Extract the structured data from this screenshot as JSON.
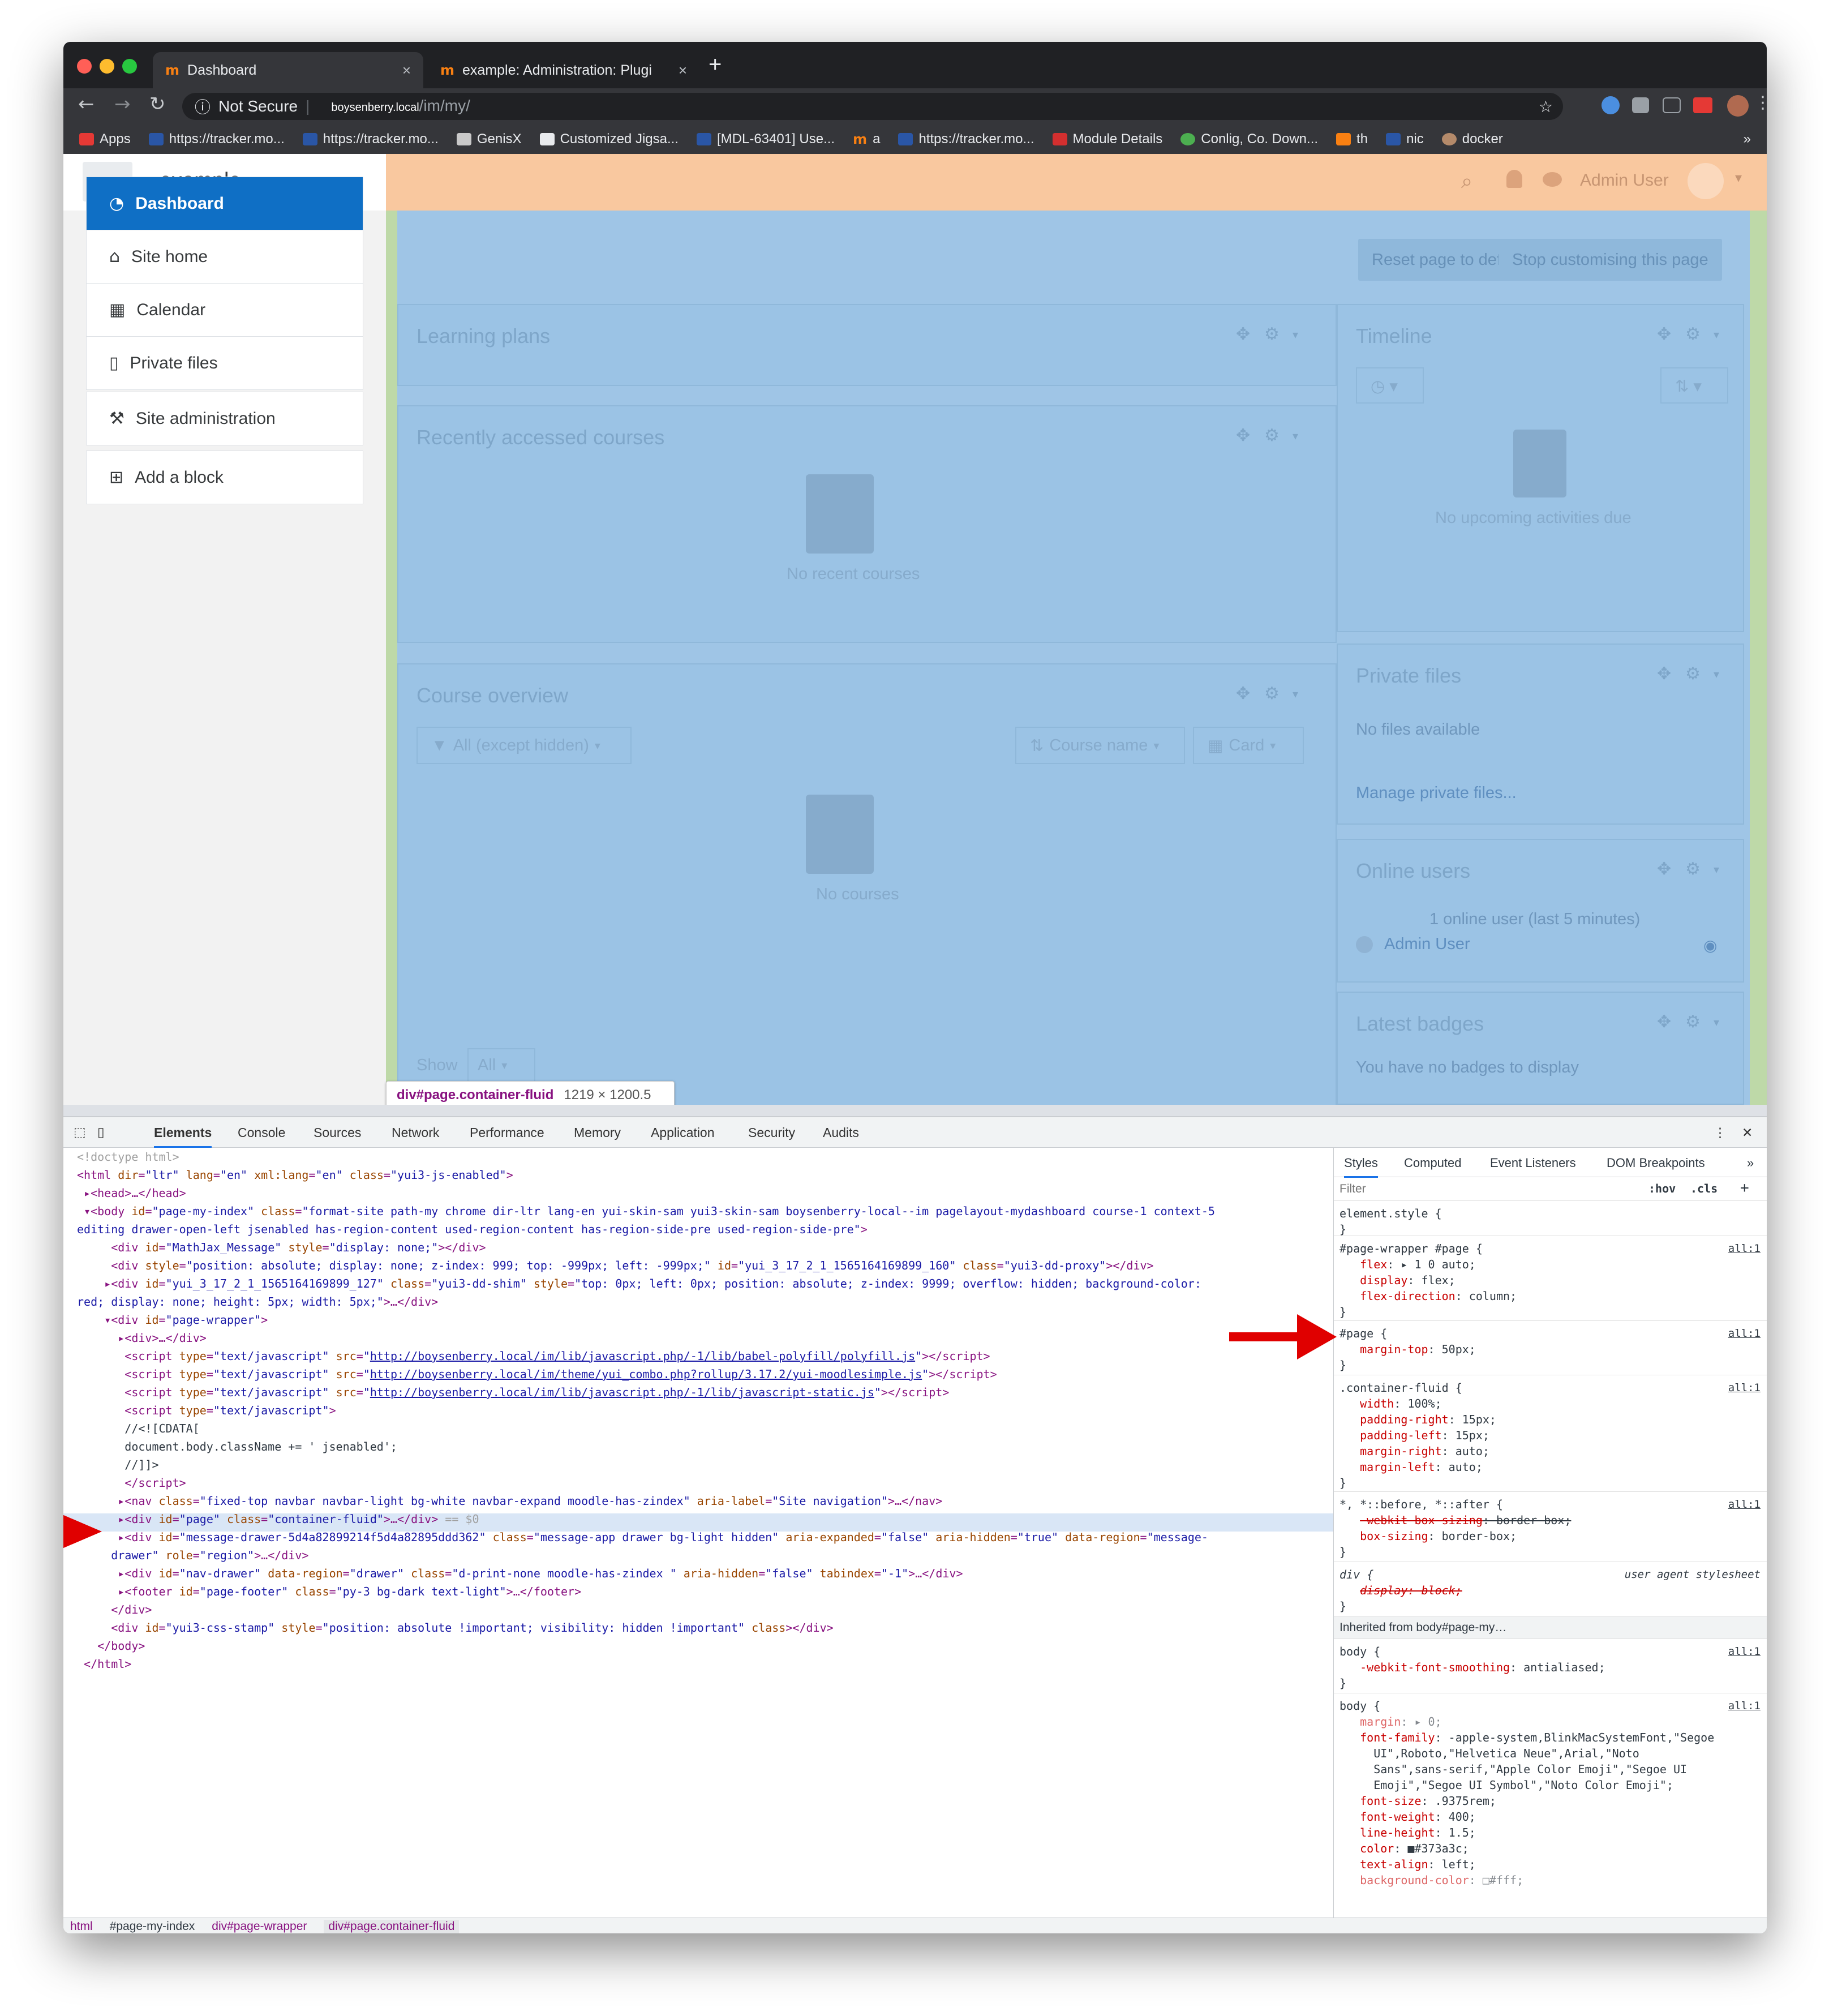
{
  "browser": {
    "tabs": [
      {
        "label": "Dashboard",
        "close": "×"
      },
      {
        "label": "example: Administration: Plugi",
        "close": "×"
      }
    ],
    "new_tab": "+",
    "security": "Not Secure",
    "url_domain": "boysenberry.local",
    "url_path": "/im/my/",
    "bookmarks": [
      "Apps",
      "https://tracker.mo...",
      "https://tracker.mo...",
      "GenisX",
      "Customized Jigsa...",
      "[MDL-63401] Use...",
      "a",
      "https://tracker.mo...",
      "Module Details",
      "Conlig, Co. Down...",
      "th",
      "nic",
      "docker"
    ],
    "bookmarks_more": "»"
  },
  "moodle": {
    "site_name": "example",
    "user": "Admin User",
    "sidebar": {
      "nav": [
        "Dashboard",
        "Site home",
        "Calendar",
        "Private files"
      ],
      "admin": "Site administration",
      "add_block": "Add a block"
    },
    "buttons": {
      "reset": "Reset page to default",
      "stop": "Stop customising this page"
    },
    "blocks": {
      "learning_plans": "Learning plans",
      "recent_courses": {
        "title": "Recently accessed courses",
        "empty": "No recent courses"
      },
      "course_overview": {
        "title": "Course overview",
        "filter": "All (except hidden)",
        "sort": "Course name",
        "view": "Card",
        "empty": "No courses",
        "show": "Show",
        "show_value": "All"
      },
      "timeline": {
        "title": "Timeline",
        "empty": "No upcoming activities due"
      },
      "private_files": {
        "title": "Private files",
        "empty": "No files available",
        "link": "Manage private files..."
      },
      "online_users": {
        "title": "Online users",
        "summary": "1 online user (last 5 minutes)",
        "user": "Admin User"
      },
      "latest_badges": {
        "title": "Latest badges",
        "empty": "You have no badges to display"
      }
    },
    "tooltip": {
      "selector": "div#page.container-fluid",
      "size": "1219 × 1200.5"
    }
  },
  "devtools": {
    "tabs": [
      "Elements",
      "Console",
      "Sources",
      "Network",
      "Performance",
      "Memory",
      "Application",
      "Security",
      "Audits"
    ],
    "style_tabs": [
      "Styles",
      "Computed",
      "Event Listeners",
      "DOM Breakpoints",
      "»"
    ],
    "filter_placeholder": "Filter",
    "hov": ":hov",
    "cls": ".cls",
    "breadcrumbs": [
      "html",
      "#page-my-index",
      "div#page-wrapper",
      "div#page.container-fluid"
    ],
    "inherited": "Inherited from body#page-my…"
  },
  "colors": {
    "accent": "#0f6fc5",
    "navbar_highlight": "#f9c89f",
    "content_highlight": "#9fc5e6",
    "padding_highlight": "#bed9a8",
    "annotation_arrow": "#e00000"
  }
}
